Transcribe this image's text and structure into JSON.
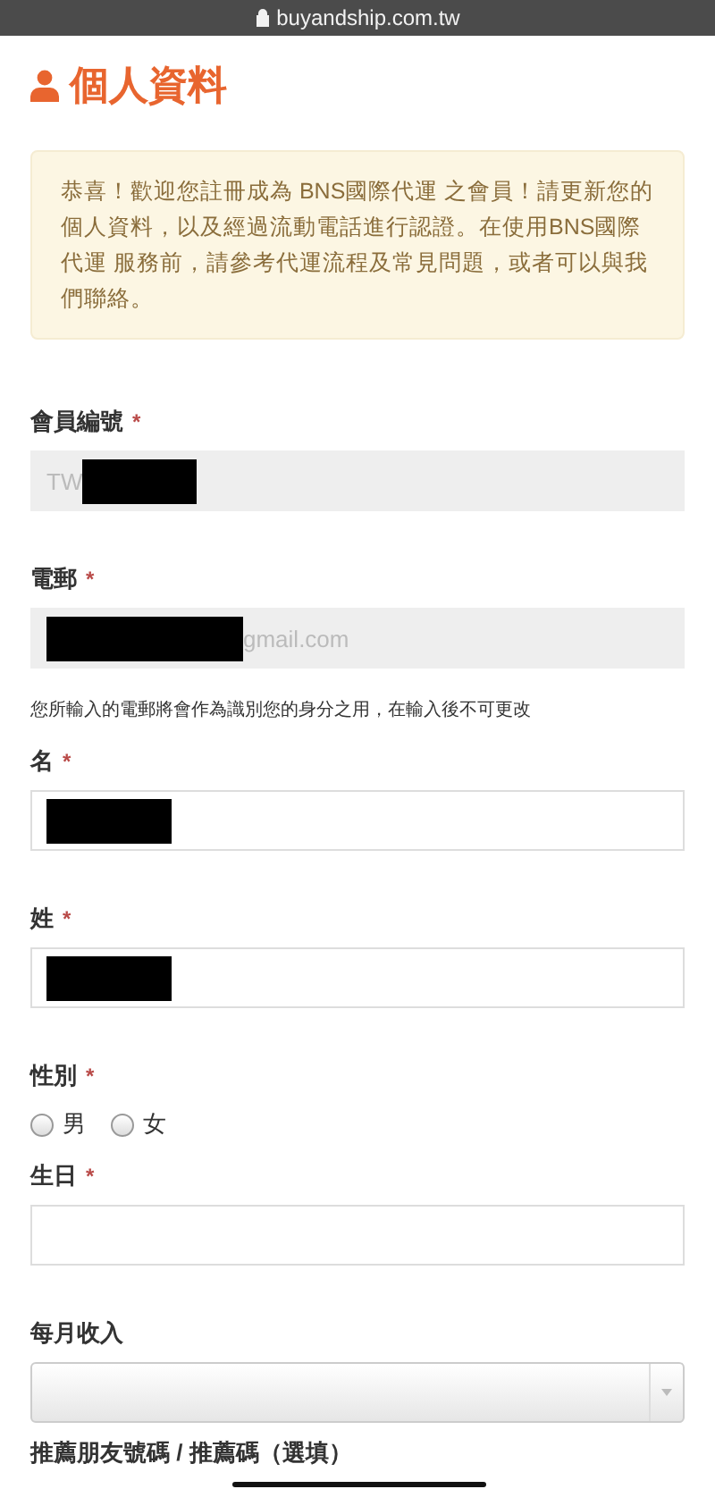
{
  "browser_bar": {
    "url": "buyandship.com.tw"
  },
  "page_title": "個人資料",
  "notice": "恭喜！歡迎您註冊成為 BNS國際代運 之會員！請更新您的個人資料，以及經過流動電話進行認證。在使用BNS國際代運 服務前，請參考代運流程及常見問題，或者可以與我們聯絡。",
  "fields": [
    {
      "kind": "text",
      "label": "會員編號",
      "required_mark": "*",
      "value": "TW",
      "disabled": true,
      "redacted": true
    },
    {
      "kind": "text",
      "label": "電郵",
      "required_mark": "*",
      "value": "gmail.com",
      "disabled": true,
      "redacted": true,
      "hint": "您所輸入的電郵將會作為識別您的身分之用，在輸入後不可更改"
    },
    {
      "kind": "text",
      "label": "名",
      "required_mark": "*",
      "disabled": false,
      "redacted": true
    },
    {
      "kind": "text",
      "label": "姓",
      "required_mark": "*",
      "disabled": false,
      "redacted": true
    },
    {
      "kind": "radio",
      "label": "性別",
      "required_mark": "*",
      "options": [
        {
          "label": "男",
          "selected": false
        },
        {
          "label": "女",
          "selected": false
        }
      ]
    },
    {
      "kind": "text",
      "label": "生日",
      "required_mark": "*",
      "disabled": false,
      "redacted": false
    },
    {
      "kind": "select",
      "label": "每月收入"
    },
    {
      "kind": "label",
      "label": "推薦朋友號碼 / 推薦碼（選填）"
    }
  ]
}
